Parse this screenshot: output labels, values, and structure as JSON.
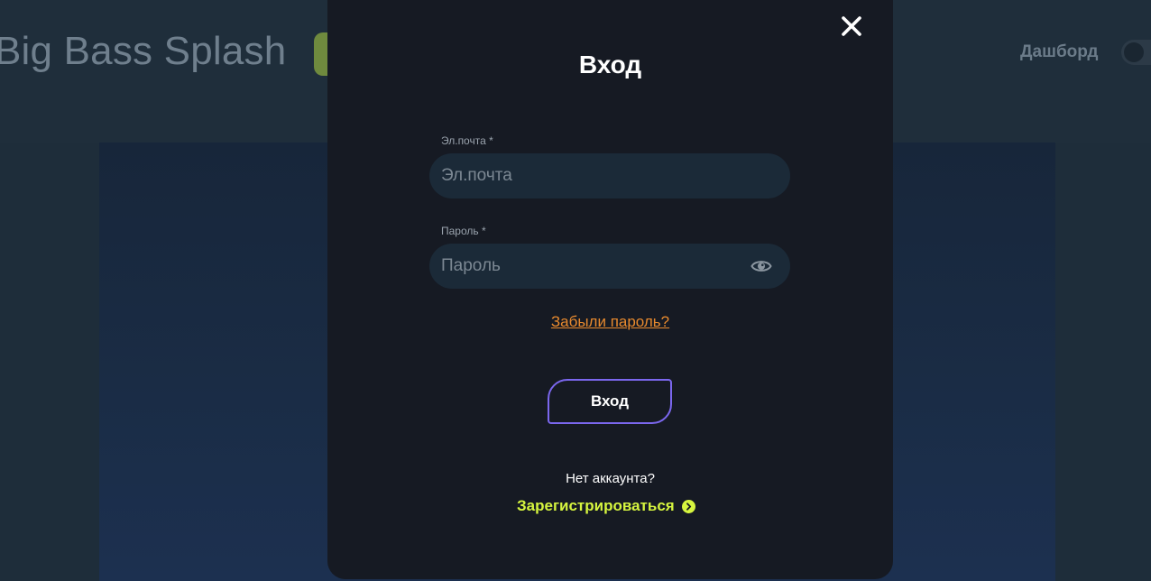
{
  "background": {
    "game_title": "Big Bass Splash",
    "dashboard_label": "Дашборд"
  },
  "modal": {
    "title": "Вход",
    "email": {
      "label": "Эл.почта *",
      "placeholder": "Эл.почта",
      "value": ""
    },
    "password": {
      "label": "Пароль *",
      "placeholder": "Пароль",
      "value": ""
    },
    "forgot_password": "Забыли пароль?",
    "submit_label": "Вход",
    "no_account_text": "Нет аккаунта?",
    "register_label": "Зарегистрироваться"
  },
  "icons": {
    "close": "close-icon",
    "eye": "eye-icon",
    "register_arrow": "chevron-right-circle-icon"
  },
  "colors": {
    "modal_bg": "#161a23",
    "field_bg": "#1b2a38",
    "accent_orange": "#e88a2e",
    "button_border": "#7b67ee",
    "register_green": "#d6f53f"
  }
}
